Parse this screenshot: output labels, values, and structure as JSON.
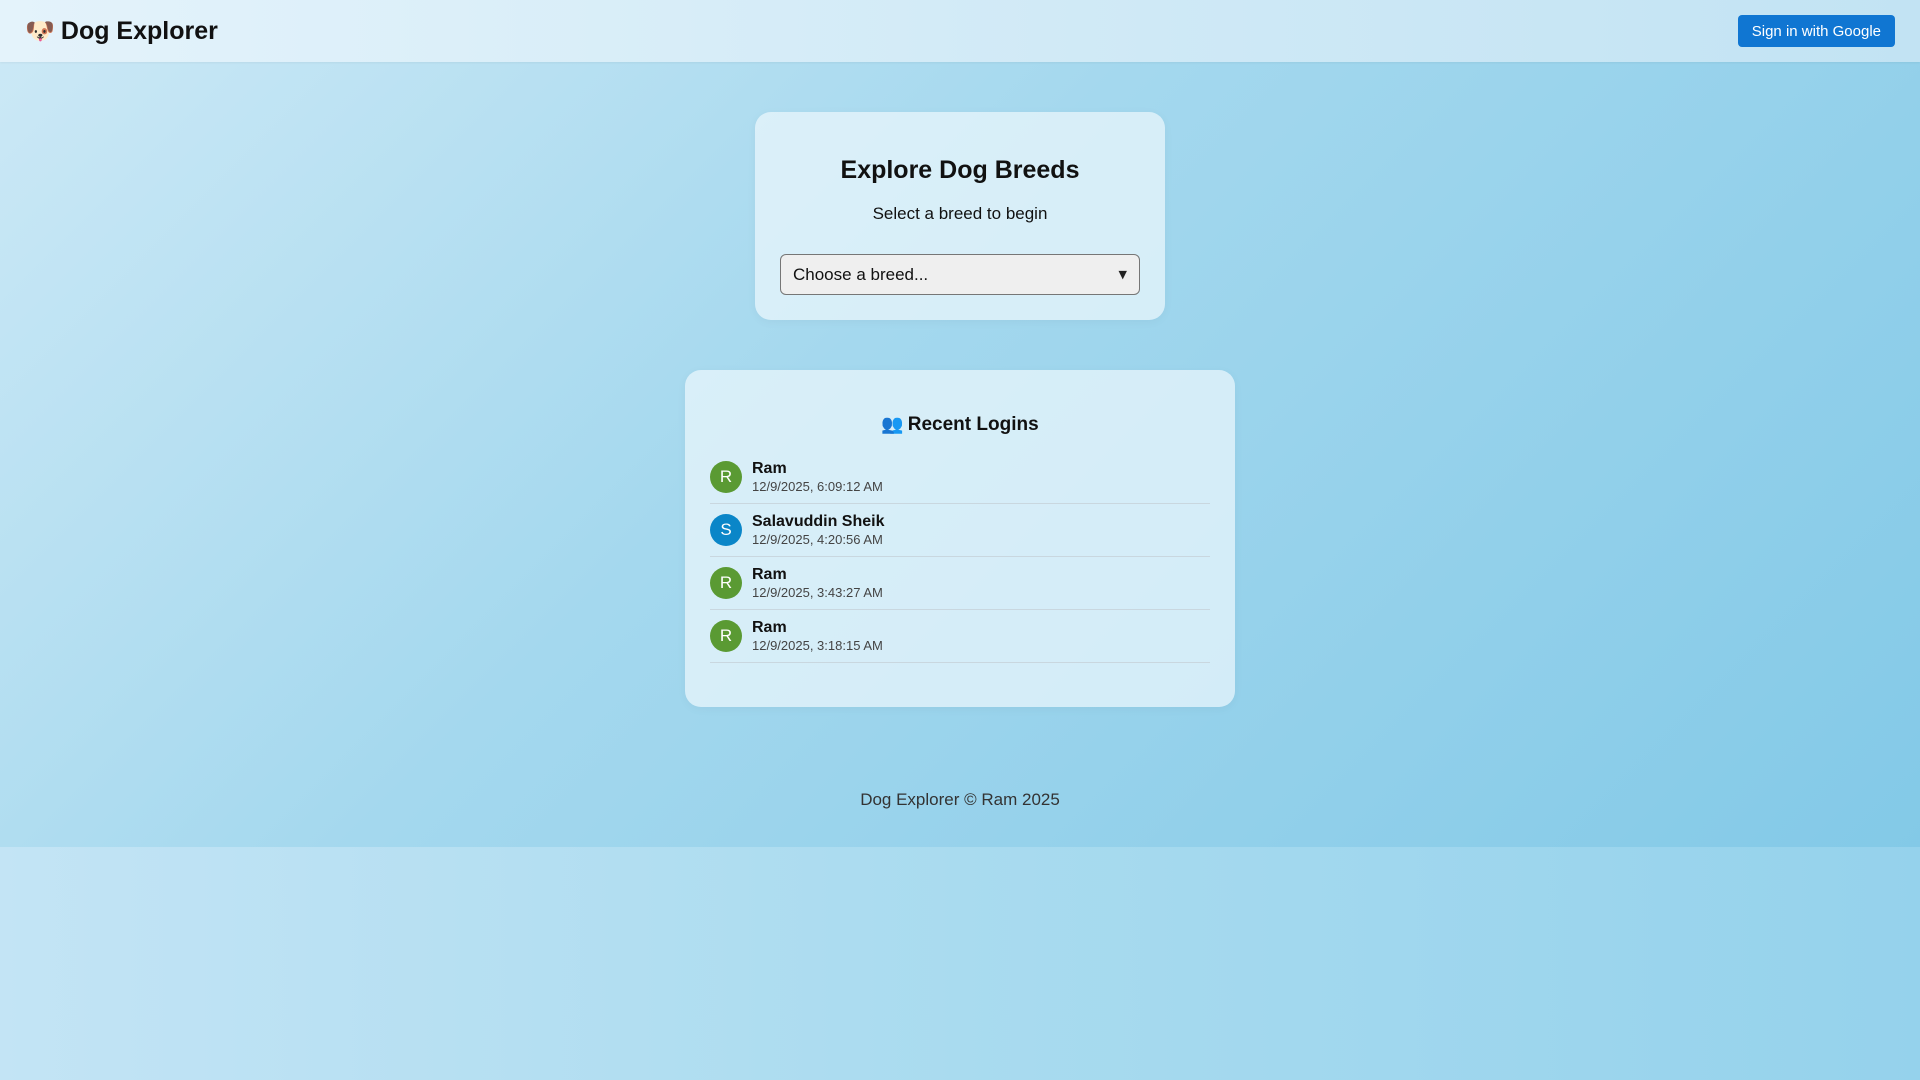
{
  "header": {
    "brand_icon": "🐶",
    "brand_title": "Dog Explorer",
    "signin_label": "Sign in with Google"
  },
  "breed_card": {
    "title": "Explore Dog Breeds",
    "subtitle": "Select a breed to begin",
    "select_value": "Choose a breed..."
  },
  "logins": {
    "icon": "👥",
    "title": "Recent Logins",
    "items": [
      {
        "initial": "R",
        "name": "Ram",
        "time": "12/9/2025, 6:09:12 AM",
        "color": "#5a9a33"
      },
      {
        "initial": "S",
        "name": "Salavuddin Sheik",
        "time": "12/9/2025, 4:20:56 AM",
        "color": "#0a86c8"
      },
      {
        "initial": "R",
        "name": "Ram",
        "time": "12/9/2025, 3:43:27 AM",
        "color": "#5a9a33"
      },
      {
        "initial": "R",
        "name": "Ram",
        "time": "12/9/2025, 3:18:15 AM",
        "color": "#5a9a33"
      }
    ]
  },
  "footer": {
    "text": "Dog Explorer © Ram 2025"
  },
  "colors": {
    "accent": "#1076d2"
  }
}
